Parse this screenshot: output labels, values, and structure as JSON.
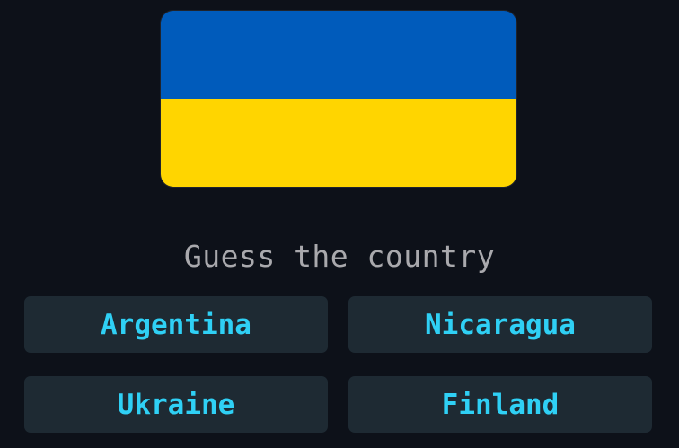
{
  "flag": {
    "country_icon": "ukraine-flag",
    "stripes": [
      {
        "color": "#005bbb"
      },
      {
        "color": "#ffd500"
      }
    ]
  },
  "prompt": "Guess the country",
  "options": [
    {
      "label": "Argentina"
    },
    {
      "label": "Nicaragua"
    },
    {
      "label": "Ukraine"
    },
    {
      "label": "Finland"
    }
  ],
  "colors": {
    "background": "#0d1119",
    "prompt_text": "#a9a9ad",
    "option_bg": "#1e2a33",
    "option_text": "#2fd0f5"
  }
}
